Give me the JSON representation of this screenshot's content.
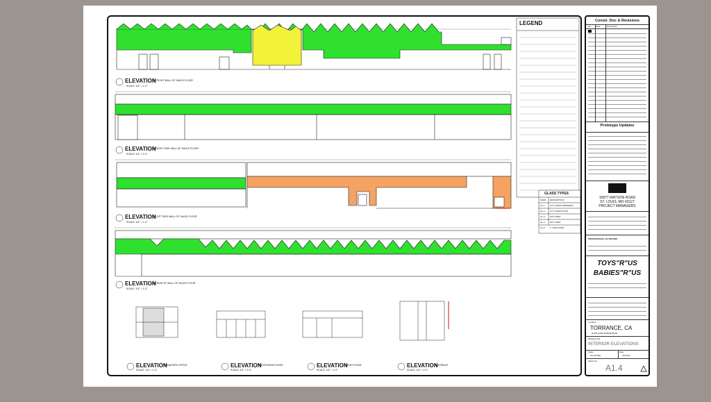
{
  "sheet": {
    "background": "#9c958f",
    "elevations": [
      {
        "title": "ELEVATION",
        "subtitle": "@ FRONT WALL OF SALES FLOOR",
        "scale": "SCALE: 1/4\" = 1'-0\""
      },
      {
        "title": "ELEVATION",
        "subtitle": "@ RIGHT SIDE WALL OF SALES FLOOR",
        "scale": "SCALE: 1/4\" = 1'-0\""
      },
      {
        "title": "ELEVATION",
        "subtitle": "@ LEFT SIDE WALL OF SALES FLOOR",
        "scale": "SCALE: 1/4\" = 1'-0\""
      },
      {
        "title": "ELEVATION",
        "subtitle": "@ REAR OF WALL OF SALES FLOOR",
        "scale": "SCALE: 1/4\" = 1'-0\""
      }
    ],
    "small_elevations": [
      {
        "title": "ELEVATION",
        "subtitle": "MANAGERS OFFICE",
        "scale": "SCALE: 1/4\" = 1'-0\""
      },
      {
        "title": "ELEVATION",
        "subtitle": "PROCESSING ROOM",
        "scale": "SCALE: 1/4\" = 1'-0\""
      },
      {
        "title": "ELEVATION",
        "subtitle": "COUNT ROOM",
        "scale": "SCALE: 1/4\" = 1'-0\""
      },
      {
        "title": "ELEVATION",
        "subtitle": "VESTIBULE",
        "scale": "SCALE: 1/4\" = 1'-0\""
      }
    ],
    "legend_title": "LEGEND",
    "glass_types": {
      "title": "GLASS TYPES",
      "headers": [
        "MARK",
        "DESCRIPTION"
      ],
      "rows": [
        [
          "GL-1",
          "1/4\" CLEAR TEMPERED"
        ],
        [
          "GL-2",
          "1/4\" CLEAR FLOAT"
        ],
        [
          "GL-3",
          "NOT USED"
        ],
        [
          "GL-4",
          "NOT USED"
        ],
        [
          "GL-5",
          "1\" INSULATED"
        ]
      ]
    },
    "colors": {
      "green": "#2fe02f",
      "yellow": "#f3f23a",
      "orange": "#f5a263"
    }
  },
  "title_block": {
    "revisions_title": "Constr. Doc & Revisions",
    "revisions_headers": [
      "No.",
      "Date",
      "Description"
    ],
    "prototype_title": "Prototype Updates",
    "firm_address": "10877 WATSON ROAD",
    "firm_city": "ST. LOUIS, MO 63127",
    "firm_role": "PROJECT MANAGERS",
    "professional_label": "PROFESSIONAL OF RECORD",
    "brand_1": "TOYS\"R\"US",
    "brand_2": "BABIES\"R\"US",
    "location_label": "Location",
    "location": "TORRANCE, CA",
    "address": "20205 HAWTHORNE BLVD.",
    "drawing_title_label": "Drawing Title",
    "drawing_title": "INTERIOR ELEVATIONS",
    "scale_label": "Scale",
    "scale_value": "AS NOTED",
    "date_label": "Date",
    "date_value": "07/26/12",
    "sheet_label": "Sheet No.",
    "sheet_no": "A1.4"
  }
}
